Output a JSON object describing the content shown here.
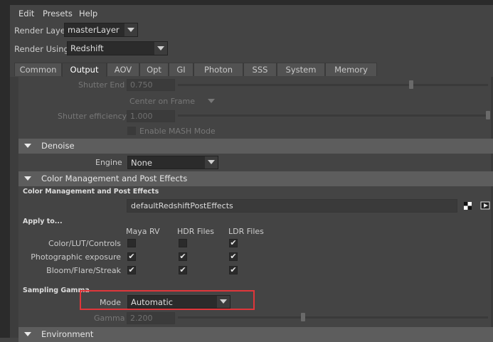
{
  "menubar": {
    "items": [
      "Edit",
      "Presets",
      "Help"
    ]
  },
  "render_layer": {
    "label": "Render Layer",
    "value": "masterLayer"
  },
  "render_using": {
    "label": "Render Using",
    "value": "Redshift"
  },
  "tabs": [
    "Common",
    "Output",
    "AOV",
    "Opt",
    "GI",
    "Photon",
    "SSS",
    "System",
    "Memory"
  ],
  "active_tab": "Output",
  "motion_blur": {
    "shutter_end_label": "Shutter End",
    "shutter_end_value": "0.750",
    "shutter_end_level": 0.75,
    "position_value": "Center on Frame",
    "shutter_efficiency_label": "Shutter efficiency",
    "shutter_efficiency_value": "1.000",
    "shutter_efficiency_level": 1.0,
    "mash_label": "Enable MASH Mode"
  },
  "denoise": {
    "header": "Denoise",
    "engine_label": "Engine",
    "engine_value": "None"
  },
  "color_mgmt": {
    "header": "Color Management and Post Effects",
    "subheader": "Color Management and Post Effects",
    "node_value": "defaultRedshiftPostEffects",
    "apply_to_label": "Apply to...",
    "columns": [
      "Maya RV",
      "HDR Files",
      "LDR Files"
    ],
    "rows": [
      {
        "label": "Color/LUT/Controls",
        "checks": [
          false,
          false,
          true
        ]
      },
      {
        "label": "Photographic exposure",
        "checks": [
          true,
          true,
          true
        ]
      },
      {
        "label": "Bloom/Flare/Streak",
        "checks": [
          true,
          true,
          true
        ]
      }
    ],
    "sampling_gamma_label": "Sampling Gamma",
    "mode_label": "Mode",
    "mode_value": "Automatic",
    "gamma_label": "Gamma",
    "gamma_value": "2.200",
    "gamma_level": 0.44
  },
  "environment": {
    "header": "Environment"
  },
  "colors": {
    "highlight": "#e0363a",
    "section_header": "#5d5d5d",
    "background": "#444444"
  },
  "icons": [
    "dropdown-arrow-icon",
    "checker-icon",
    "connect-arrow-icon",
    "expand-triangle-icon",
    "checkmark-icon"
  ]
}
